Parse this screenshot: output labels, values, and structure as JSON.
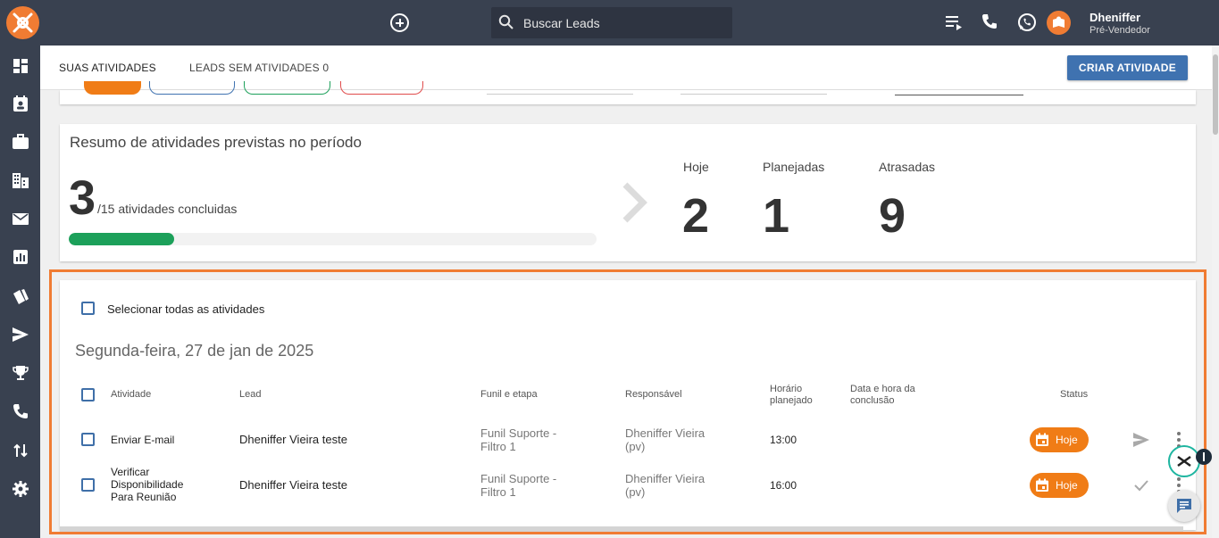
{
  "header": {
    "search_placeholder": "Buscar Leads",
    "user_name": "Dheniffer",
    "user_role": "Pré-Vendedor"
  },
  "tabs": [
    {
      "label": "SUAS ATIVIDADES",
      "active": true
    },
    {
      "label": "LEADS SEM ATIVIDADES 0",
      "active": false
    }
  ],
  "create_button": "CRIAR ATIVIDADE",
  "summary": {
    "title": "Resumo de atividades previstas no período",
    "completed": "3",
    "completed_suffix": "/15 atividades concluidas",
    "progress_fraction": 0.2,
    "stats": [
      {
        "label": "Hoje",
        "value": "2"
      },
      {
        "label": "Planejadas",
        "value": "1"
      },
      {
        "label": "Atrasadas",
        "value": "9"
      }
    ]
  },
  "activities": {
    "select_all_label": "Selecionar todas as atividades",
    "date_heading": "Segunda-feira, 27 de jan de 2025",
    "columns": {
      "activity": "Atividade",
      "lead": "Lead",
      "funnel": "Funil e etapa",
      "owner": "Responsável",
      "planned": "Horário planejado",
      "completed_at": "Data e hora da conclusão",
      "status": "Status"
    },
    "rows": [
      {
        "activity": "Enviar E-mail",
        "lead": "Dheniffer Vieira teste",
        "funnel": "Funil Suporte - Filtro 1",
        "owner": "Dheniffer Vieira (pv)",
        "time": "13:00",
        "status": "Hoje",
        "action_icon": "send-icon"
      },
      {
        "activity": "Verificar Disponibilidade Para Reunião",
        "lead": "Dheniffer Vieira teste",
        "funnel": "Funil Suporte - Filtro 1",
        "owner": "Dheniffer Vieira (pv)",
        "time": "16:00",
        "status": "Hoje",
        "action_icon": "check-icon"
      }
    ]
  },
  "colors": {
    "topbar": "#394150",
    "accent": "#f07c33",
    "primary_button": "#3f72b0",
    "progress": "#1ca05a",
    "status_chip": "#f07c16"
  }
}
